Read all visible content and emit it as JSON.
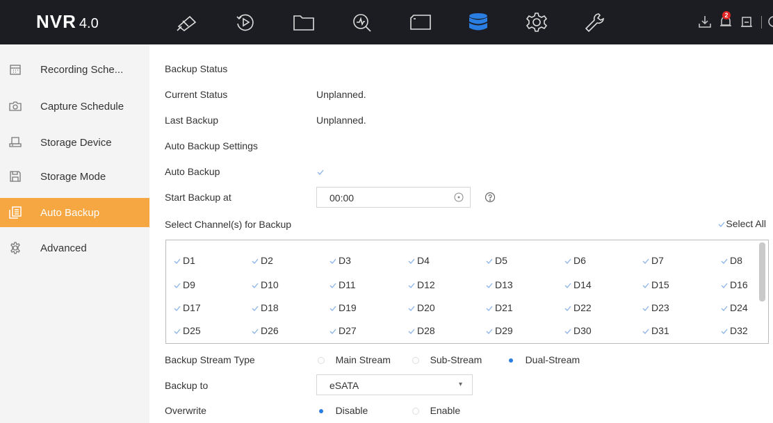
{
  "header": {
    "logo_main": "NVR",
    "logo_version": "4.0",
    "nav_icons": [
      "live-view-icon",
      "playback-icon",
      "file-management-icon",
      "smart-analysis-icon",
      "channel-icon",
      "storage-icon",
      "configuration-icon",
      "maintenance-icon"
    ],
    "active_nav": "storage-icon",
    "accent_color": "#2a7de1",
    "alarm_count": "2"
  },
  "sidebar": {
    "items": [
      {
        "label": "Recording Sche...",
        "icon": "calendar-icon"
      },
      {
        "label": "Capture Schedule",
        "icon": "camera-icon"
      },
      {
        "label": "Storage Device",
        "icon": "storage-device-icon"
      },
      {
        "label": "Storage Mode",
        "icon": "save-icon"
      },
      {
        "label": "Auto Backup",
        "icon": "backup-icon"
      },
      {
        "label": "Advanced",
        "icon": "gear-icon"
      }
    ],
    "active_index": 4,
    "active_color": "#f6a742"
  },
  "main": {
    "backup_status_title": "Backup Status",
    "current_status_label": "Current Status",
    "current_status_value": "Unplanned.",
    "last_backup_label": "Last Backup",
    "last_backup_value": "Unplanned.",
    "auto_backup_settings_title": "Auto Backup Settings",
    "auto_backup_label": "Auto Backup",
    "auto_backup_checked": true,
    "start_backup_label": "Start Backup at",
    "start_backup_value": "00:00",
    "select_channels_label": "Select Channel(s) for Backup",
    "select_all_label": "Select All",
    "channels": [
      "D1",
      "D2",
      "D3",
      "D4",
      "D5",
      "D6",
      "D7",
      "D8",
      "D9",
      "D10",
      "D11",
      "D12",
      "D13",
      "D14",
      "D15",
      "D16",
      "D17",
      "D18",
      "D19",
      "D20",
      "D21",
      "D22",
      "D23",
      "D24",
      "D25",
      "D26",
      "D27",
      "D28",
      "D29",
      "D30",
      "D31",
      "D32"
    ],
    "stream_type_label": "Backup Stream Type",
    "stream_options": [
      "Main Stream",
      "Sub-Stream",
      "Dual-Stream"
    ],
    "stream_selected": "Dual-Stream",
    "backup_to_label": "Backup to",
    "backup_to_value": "eSATA",
    "overwrite_label": "Overwrite",
    "overwrite_options": [
      "Disable",
      "Enable"
    ],
    "overwrite_selected": "Disable"
  }
}
